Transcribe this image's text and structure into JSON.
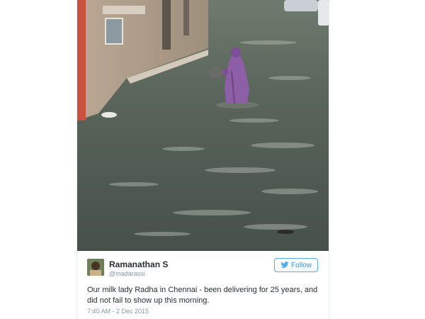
{
  "tweet": {
    "author_name": "Ramanathan S",
    "handle": "@madarassi",
    "follow_label": "Follow",
    "text": "Our milk lady Radha in Chennai - been delivering for 25 years, and did not fail to show up this morning.",
    "timestamp": "7:40 AM - 2 Dec 2015"
  },
  "colors": {
    "brand_blue": "#55acee",
    "text_dark": "#292f33",
    "text_muted": "#8899a6"
  },
  "icons": {
    "follow": "twitter-bird-icon"
  }
}
